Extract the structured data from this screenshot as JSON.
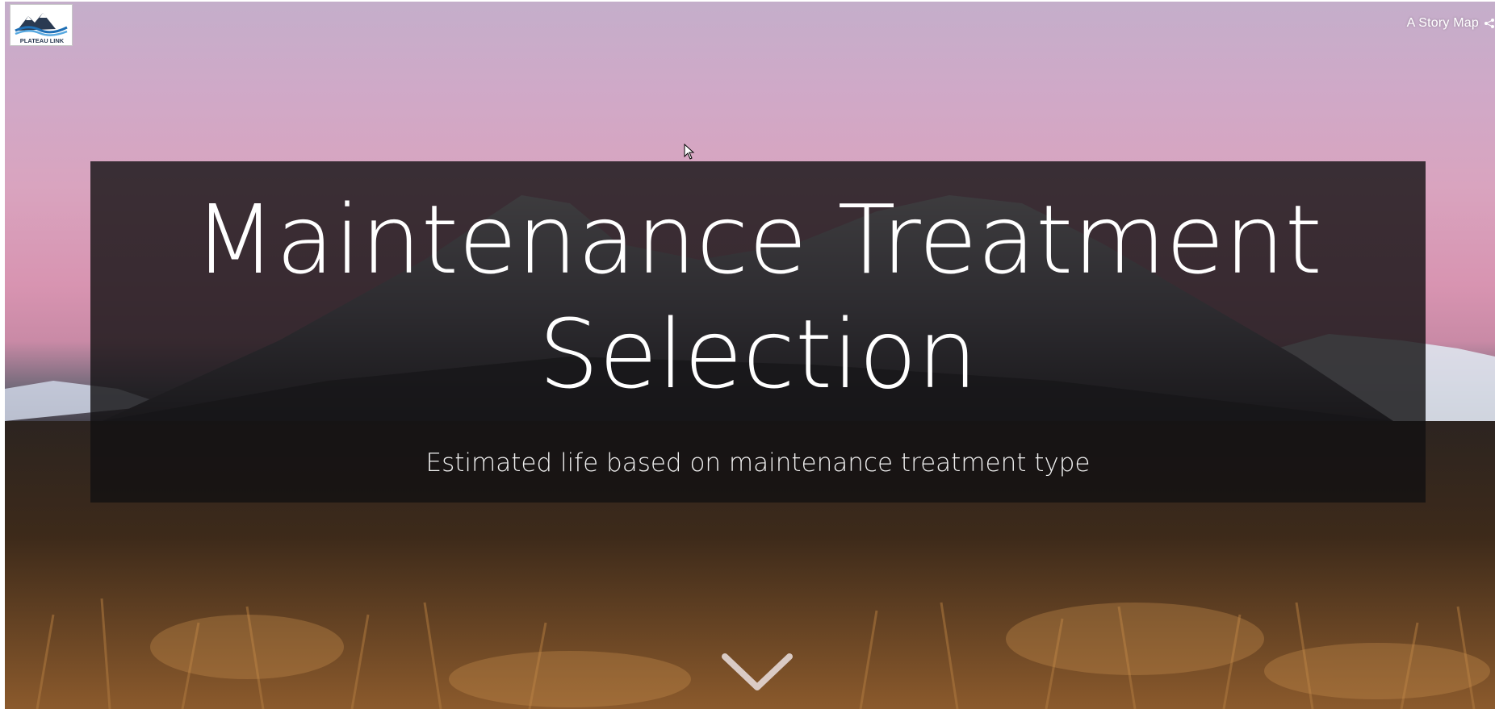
{
  "header": {
    "logo_text": "PLATEAU LINK",
    "story_map_label": "A Story Map"
  },
  "hero": {
    "title": "Maintenance Treatment Selection",
    "subtitle": "Estimated life based on maintenance treatment type"
  },
  "icons": {
    "share": "share-icon",
    "scroll": "chevron-down-icon",
    "cursor": "mouse-pointer-icon"
  },
  "colors": {
    "panel": "#121011",
    "sky_top": "#c4aeca",
    "sky_pink": "#d894b1",
    "grass": "#8a5a2d",
    "logo_blue": "#1f6fb5"
  }
}
